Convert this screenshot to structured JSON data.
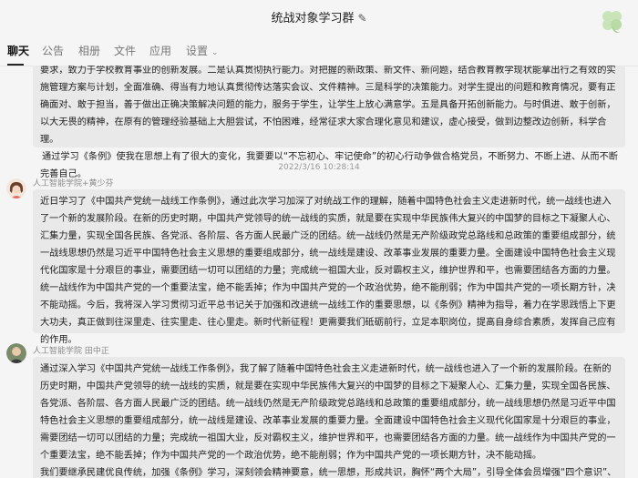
{
  "window": {
    "title": "统战对象学习群",
    "edit_icon": "pencil-icon",
    "decoration_icon": "clover-icon"
  },
  "tabs": [
    {
      "label": "聊天",
      "active": true
    },
    {
      "label": "公告",
      "active": false
    },
    {
      "label": "相册",
      "active": false
    },
    {
      "label": "文件",
      "active": false
    },
    {
      "label": "应用",
      "active": false
    },
    {
      "label": "设置",
      "active": false,
      "dropdown_icon": "chevron-down-icon"
    }
  ],
  "messages": [
    {
      "sender": "",
      "timestamp": "",
      "paragraphs": [
        "要求，致力于学校教育事业的创新发展。二是认真贯彻执行能力。对把握的新政策、新文件、新问题，结合教育教学现状能拿出行之有效的实施管理方案与计划，全面准确、得当有力地认真贯彻传达落实会议、文件精神。三是科学的决策能力。对学生提出的问题和教育情况，要有正确面对、敢于担当，善于做出正确决策解决问题的能力，服务于学生，让学生上放心满意学。五是具备开拓创新能力。与时俱进、敢于创新，以大无畏的精神，在原有的管理经验基础上大胆尝试，不怕困难，经常征求大家合理化意见和建议，虚心接受，做到边整改边创新，科学合理。",
        "通过学习《条例》使我在思想上有了很大的变化，我要要以“不忘初心、牢记使命”的初心行动争做合格党员，不断努力、不断上进、从而不断完善自己。"
      ]
    },
    {
      "sender": "人工智能学院+黄少芬",
      "timestamp": "2022/3/16 10:28:14",
      "avatar_icon": "woman-avatar-icon",
      "paragraphs": [
        "近日学习了《中国共产党统一战线工作条例》，通过此次学习加深了对统战工作的理解，随着中国特色社会主义走进新时代，统一战线也进入了一个新的发展阶段。在新的历史时期，中国共产党领导的统一战线的实质，就是要在实现中华民族伟大复兴的中国梦的目标之下凝聚人心、汇集力量，实现全国各民族、各党派、各阶层、各方面人民最广泛的团结。统一战线仍然是无产阶级政党总路线和总政策的重要组成部分，统一战线思想仍然是习近平中国特色社会主义思想的重要组成部分，统一战线是建设、改革事业发展的重要力量。全面建设中国特色社会主义现代化国家是十分艰巨的事业，需要团结一切可以团结的力量；完成统一祖国大业，反对霸权主义，维护世界和平，也需要团结各方面的力量。统一战线作为中国共产党的一个重要法宝，绝不能丢掉；作为中国共产党的一个政治优势，绝不能削弱；作为中国共产党的一项长期方针，决不能动摇。今后，我将深入学习贯彻习近平总书记关于加强和改进统一战线工作的重要思想，以《条例》精神为指导，着力在学思践悟上下更大功夫，真正做到往深里走、往实里走、往心里走。新时代新征程！更需要我们砥砺前行，立足本职岗位，提高自身综合素质，发挥自己应有的作用。"
      ]
    },
    {
      "sender": "人工智能学院 田中正",
      "timestamp": "",
      "avatar_icon": "man-avatar-icon",
      "paragraphs": [
        "通过深入学习《中国共产党统一战线工作条例》，我了解了随着中国特色社会主义走进新时代，统一战线也进入了一个新的发展阶段。在新的历史时期，中国共产党领导的统一战线的实质，就是要在实现中华民族伟大复兴的中国梦的目标之下凝聚人心、汇集力量，实现全国各民族、各党派、各阶层、各方面人民最广泛的团结。统一战线仍然是无产阶级政党总路线和总政策的重要组成部分，统一战线思想仍然是习近平中国特色社会主义思想的重要组成部分，统一战线是建设、改革事业发展的重要力量。全面建设中国特色社会主义现代化国家是十分艰巨的事业，需要团结一切可以团结的力量；完成统一祖国大业，反对霸权主义，维护世界和平，也需要团结各方面的力量。统一战线作为中国共产党的一个重要法宝，绝不能丢掉；作为中国共产党的一个政治优势，绝不能削弱；作为中国共产党的一项长期方针，决不能动摇。",
        "我们要继承民建优良传统，加强《条例》学习，深刻领会精神要意，统一思想，形成共识，胸怀“两个大局”，引导全体会员增强“四个意识”、坚定“四个自"
      ]
    }
  ],
  "colors": {
    "background": "#f5f5f5",
    "bubble": "#e9e9e9",
    "text": "#1e1e1e",
    "muted": "#8a8a8a"
  }
}
